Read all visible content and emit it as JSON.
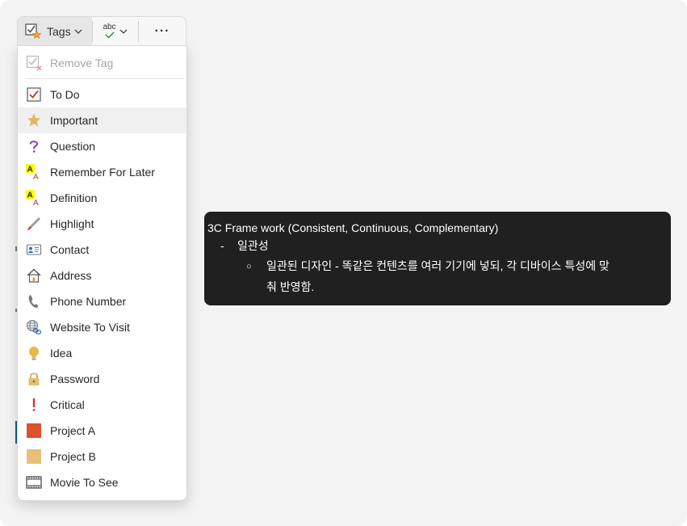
{
  "toolbar": {
    "tags_label": "Tags",
    "tags_icon": "tag-checkbox-star-icon",
    "spell_label": "abc",
    "spell_icon": "spelling-check-icon",
    "more_label": "···",
    "more_icon": "more-options-icon"
  },
  "menu": {
    "remove_tag": "Remove Tag",
    "items": [
      {
        "label": "To Do",
        "icon": "checkbox-icon"
      },
      {
        "label": "Important",
        "icon": "star-icon"
      },
      {
        "label": "Question",
        "icon": "question-icon"
      },
      {
        "label": "Remember For Later",
        "icon": "highlight-a-icon"
      },
      {
        "label": "Definition",
        "icon": "highlight-a-icon"
      },
      {
        "label": "Highlight",
        "icon": "highlighter-pen-icon"
      },
      {
        "label": "Contact",
        "icon": "contact-card-icon"
      },
      {
        "label": "Address",
        "icon": "house-icon"
      },
      {
        "label": "Phone Number",
        "icon": "phone-icon"
      },
      {
        "label": "Website To Visit",
        "icon": "globe-link-icon"
      },
      {
        "label": "Idea",
        "icon": "lightbulb-icon"
      },
      {
        "label": "Password",
        "icon": "lock-icon"
      },
      {
        "label": "Critical",
        "icon": "exclamation-icon"
      },
      {
        "label": "Project A",
        "icon": "red-square-icon"
      },
      {
        "label": "Project B",
        "icon": "tan-square-icon"
      },
      {
        "label": "Movie To See",
        "icon": "film-strip-icon"
      }
    ]
  },
  "tooltip": {
    "line1": "3C Frame work (Consistent, Continuous, Complementary)",
    "bullet1": "-",
    "line2": "일관성",
    "bullet2": "○",
    "line3": "일관된 디자인 - 똑같은 컨텐츠를 여러 기기에 넣되, 각 디바이스 특성에 맞",
    "line4": "춰 반영함."
  },
  "colors": {
    "star": "#e0b867",
    "question": "#8a4fbe",
    "highlight_yellow": "#ffff00",
    "letter_red": "#c0392b",
    "project_a": "#d9532c",
    "project_b": "#e8c07a",
    "critical": "#d13438",
    "tooltip_bg": "#202020"
  }
}
